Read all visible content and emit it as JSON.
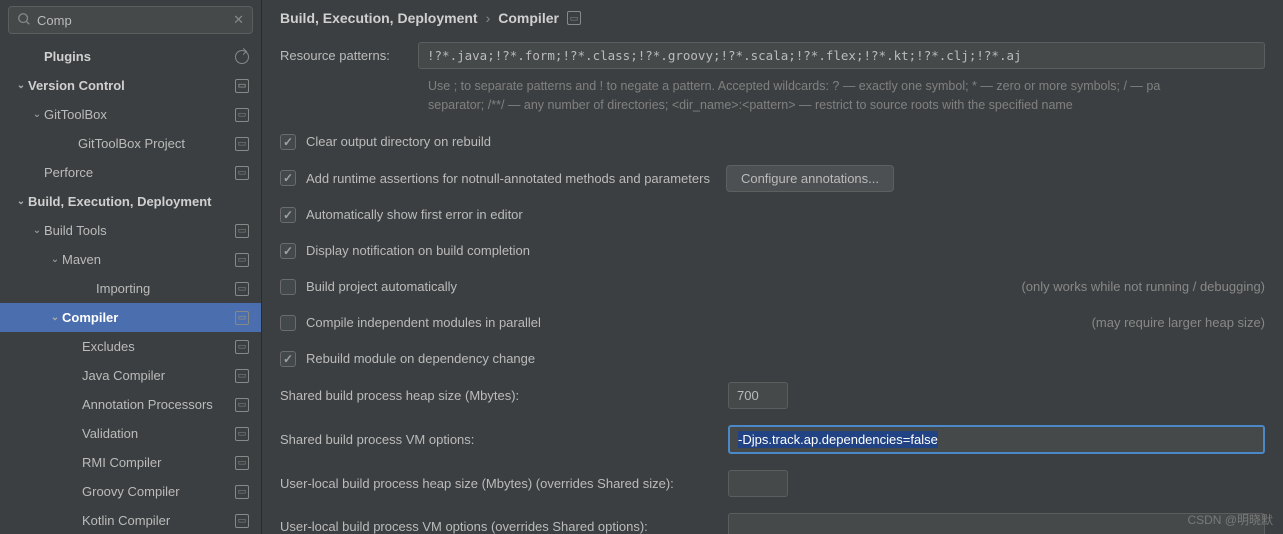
{
  "search": {
    "value": "Comp"
  },
  "sidebar": {
    "items": [
      {
        "label": "Plugins",
        "indent": 30,
        "bold": true,
        "chev": "",
        "mod": false,
        "reset": true
      },
      {
        "label": "Version Control",
        "indent": 14,
        "bold": true,
        "chev": "down",
        "mod": true
      },
      {
        "label": "GitToolBox",
        "indent": 30,
        "bold": false,
        "chev": "down",
        "mod": true
      },
      {
        "label": "GitToolBox Project",
        "indent": 64,
        "bold": false,
        "chev": "",
        "mod": true
      },
      {
        "label": "Perforce",
        "indent": 30,
        "bold": false,
        "chev": "",
        "mod": true
      },
      {
        "label": "Build, Execution, Deployment",
        "indent": 14,
        "bold": true,
        "chev": "down",
        "mod": false
      },
      {
        "label": "Build Tools",
        "indent": 30,
        "bold": false,
        "chev": "down",
        "mod": true
      },
      {
        "label": "Maven",
        "indent": 48,
        "bold": false,
        "chev": "down",
        "mod": true
      },
      {
        "label": "Importing",
        "indent": 82,
        "bold": false,
        "chev": "",
        "mod": true
      },
      {
        "label": "Compiler",
        "indent": 48,
        "bold": true,
        "chev": "down",
        "mod": true,
        "selected": true
      },
      {
        "label": "Excludes",
        "indent": 68,
        "bold": false,
        "chev": "",
        "mod": true
      },
      {
        "label": "Java Compiler",
        "indent": 68,
        "bold": false,
        "chev": "",
        "mod": true
      },
      {
        "label": "Annotation Processors",
        "indent": 68,
        "bold": false,
        "chev": "",
        "mod": true
      },
      {
        "label": "Validation",
        "indent": 68,
        "bold": false,
        "chev": "",
        "mod": true
      },
      {
        "label": "RMI Compiler",
        "indent": 68,
        "bold": false,
        "chev": "",
        "mod": true
      },
      {
        "label": "Groovy Compiler",
        "indent": 68,
        "bold": false,
        "chev": "",
        "mod": true
      },
      {
        "label": "Kotlin Compiler",
        "indent": 68,
        "bold": false,
        "chev": "",
        "mod": true
      }
    ]
  },
  "breadcrumb": {
    "a": "Build, Execution, Deployment",
    "b": "Compiler"
  },
  "resource": {
    "label": "Resource patterns:",
    "value": "!?*.java;!?*.form;!?*.class;!?*.groovy;!?*.scala;!?*.flex;!?*.kt;!?*.clj;!?*.aj",
    "help1": "Use ; to separate patterns and ! to negate a pattern. Accepted wildcards: ? — exactly one symbol; * — zero or more symbols; / — pa",
    "help2": "separator; /**/ — any number of directories; <dir_name>:<pattern> — restrict to source roots with the specified name"
  },
  "checks": [
    {
      "label": "Clear output directory on rebuild",
      "checked": true
    },
    {
      "label": "Add runtime assertions for notnull-annotated methods and parameters",
      "checked": true,
      "button": "Configure annotations..."
    },
    {
      "label": "Automatically show first error in editor",
      "checked": true
    },
    {
      "label": "Display notification on build completion",
      "checked": true
    },
    {
      "label": "Build project automatically",
      "checked": false,
      "hint": "(only works while not running / debugging)"
    },
    {
      "label": "Compile independent modules in parallel",
      "checked": false,
      "hint": "(may require larger heap size)"
    },
    {
      "label": "Rebuild module on dependency change",
      "checked": true
    }
  ],
  "fields": {
    "heap_label": "Shared build process heap size (Mbytes):",
    "heap_value": "700",
    "vm_label": "Shared build process VM options:",
    "vm_value": "-Djps.track.ap.dependencies=false",
    "uheap_label": "User-local build process heap size (Mbytes) (overrides Shared size):",
    "uheap_value": "",
    "uvm_label": "User-local build process VM options (overrides Shared options):",
    "uvm_value": ""
  },
  "watermark": "CSDN @明晓默"
}
